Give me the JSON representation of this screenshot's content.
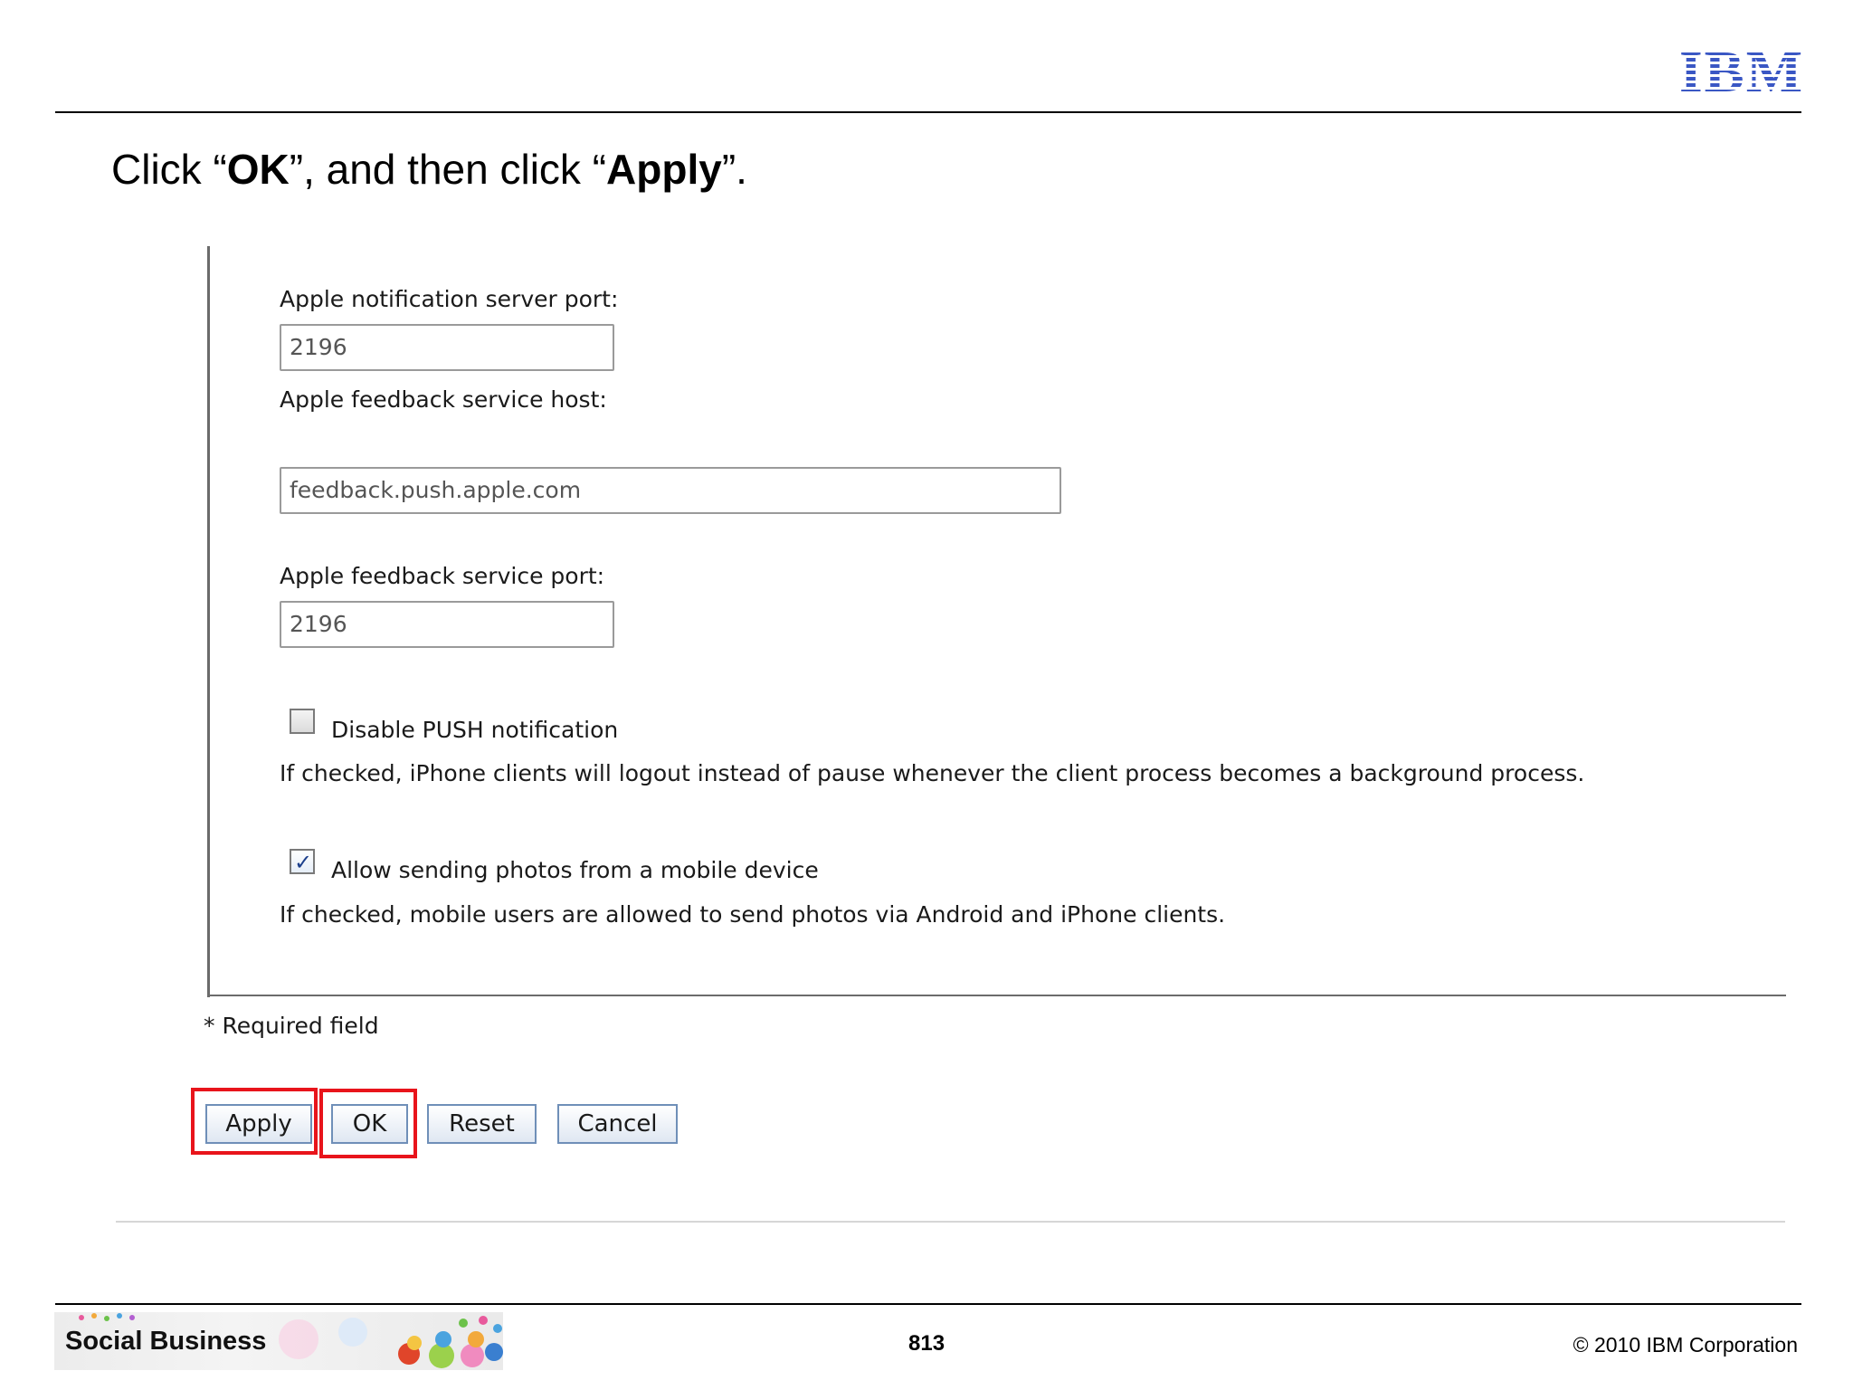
{
  "slide": {
    "instruction": {
      "prefix": "Click “",
      "ok_word": "OK",
      "middle": "”, and then click “",
      "apply_word": "Apply",
      "suffix": "”."
    },
    "logo_text": "IBM",
    "footer": {
      "banner_text": "Social Business",
      "page_number": "813",
      "copyright": "© 2010 IBM Corporation"
    }
  },
  "form": {
    "apns_port_label": "Apple notification server port:",
    "apns_port_value": "2196",
    "feedback_host_label": "Apple feedback service host:",
    "feedback_host_value": "feedback.push.apple.com",
    "feedback_port_label": "Apple feedback service port:",
    "feedback_port_value": "2196",
    "disable_push": {
      "label": "Disable PUSH notification",
      "checked": false,
      "note": "If checked, iPhone clients will logout instead of pause whenever the client process becomes a background process."
    },
    "allow_photos": {
      "label": "Allow sending photos from a mobile device",
      "checked": true,
      "note": "If checked, mobile users are allowed to send photos via Android and iPhone clients."
    },
    "required_note": "* Required field"
  },
  "buttons": {
    "apply": "Apply",
    "ok": "OK",
    "reset": "Reset",
    "cancel": "Cancel"
  },
  "colors": {
    "highlight": "#e8141b",
    "logo_blue": "#3a57c4",
    "button_border": "#6f8fb8"
  }
}
